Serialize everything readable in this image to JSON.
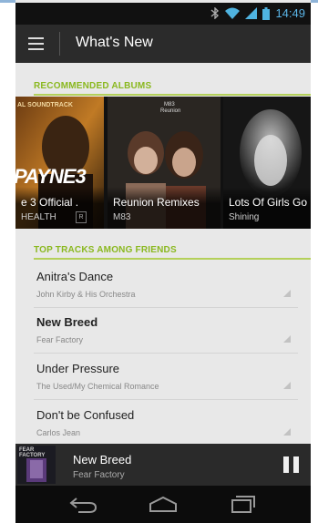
{
  "status_bar": {
    "time": "14:49",
    "icons": [
      "bluetooth-icon",
      "wifi-icon",
      "signal-icon",
      "battery-icon"
    ]
  },
  "action_bar": {
    "title": "What's New",
    "menu_icon": "hamburger-menu-icon"
  },
  "recommended_albums": {
    "heading": "RECOMMENDED ALBUMS",
    "items": [
      {
        "name": "e 3 Official .",
        "artist": "HEALTH",
        "art_text": "PAYNE3",
        "art_subtext": "AL SOUNDTRACK"
      },
      {
        "name": "Reunion Remixes",
        "artist": "M83",
        "art_text": "M83",
        "art_subtext": "Reunion"
      },
      {
        "name": "Lots Of Girls Go",
        "artist": "Shining"
      }
    ]
  },
  "top_tracks": {
    "heading": "TOP TRACKS AMONG FRIENDS",
    "items": [
      {
        "title": "Anitra's Dance",
        "artist": "John Kirby & His Orchestra",
        "playing": false
      },
      {
        "title": "New Breed",
        "artist": "Fear Factory",
        "playing": true
      },
      {
        "title": "Under Pressure",
        "artist": "The Used/My Chemical Romance",
        "playing": false
      },
      {
        "title": "Don't be Confused",
        "artist": "Carlos Jean",
        "playing": false
      }
    ]
  },
  "now_playing": {
    "title": "New Breed",
    "artist": "Fear Factory",
    "thumb_text": "FEAR FACTORY",
    "control_icon": "pause-icon"
  },
  "colors": {
    "accent_green": "#8ab81f",
    "status_blue": "#5ab4e6",
    "action_bar": "#2b2b2b",
    "background": "#e8e8e8"
  },
  "nav_bar": {
    "icons": [
      "back-icon",
      "home-icon",
      "recent-apps-icon"
    ]
  }
}
